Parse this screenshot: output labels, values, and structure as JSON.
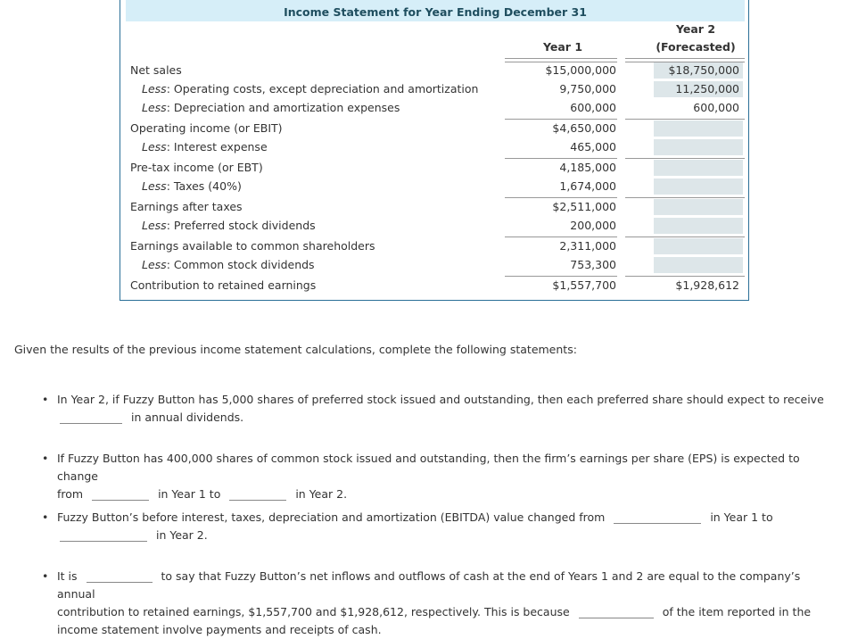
{
  "statement": {
    "title": "Income Statement for Year Ending December 31",
    "col_year1": "Year 1",
    "col_year2_line1": "Year 2",
    "col_year2_line2": "(Forecasted)",
    "rows": [
      {
        "prefix": "",
        "label": "Net sales",
        "year1": "$15,000,000",
        "year2": "$18,750,000",
        "year2_input": true
      },
      {
        "prefix": "Less",
        "label": ": Operating costs, except depreciation and amortization",
        "year1": "9,750,000",
        "year2": "11,250,000",
        "year2_input": true
      },
      {
        "prefix": "Less",
        "label": ": Depreciation and amortization expenses",
        "year1": "600,000",
        "year2": "600,000",
        "year2_input": false
      },
      {
        "prefix": "",
        "label": "Operating income (or EBIT)",
        "year1": "$4,650,000",
        "year2": "",
        "year2_input": true
      },
      {
        "prefix": "Less",
        "label": ": Interest expense",
        "year1": "465,000",
        "year2": "",
        "year2_input": true
      },
      {
        "prefix": "",
        "label": "Pre-tax income (or EBT)",
        "year1": "4,185,000",
        "year2": "",
        "year2_input": true
      },
      {
        "prefix": "Less",
        "label": ": Taxes (40%)",
        "year1": "1,674,000",
        "year2": "",
        "year2_input": true
      },
      {
        "prefix": "",
        "label": "Earnings after taxes",
        "year1": "$2,511,000",
        "year2": "",
        "year2_input": true
      },
      {
        "prefix": "Less",
        "label": ": Preferred stock dividends",
        "year1": "200,000",
        "year2": "",
        "year2_input": true
      },
      {
        "prefix": "",
        "label": "Earnings available to common shareholders",
        "year1": "2,311,000",
        "year2": "",
        "year2_input": true
      },
      {
        "prefix": "Less",
        "label": ": Common stock dividends",
        "year1": "753,300",
        "year2": "",
        "year2_input": true
      },
      {
        "prefix": "",
        "label": "Contribution to retained earnings",
        "year1": "$1,557,700",
        "year2": "$1,928,612",
        "year2_input": false
      }
    ]
  },
  "questions": {
    "intro": "Given the results of the previous income statement calculations, complete the following statements:",
    "q1": {
      "part1": "In Year 2, if Fuzzy Button has 5,000 shares of preferred stock issued and outstanding, then each preferred share should expect to receive",
      "part2": "in annual dividends."
    },
    "q2": {
      "part1": "If Fuzzy Button has 400,000 shares of common stock issued and outstanding, then the firm’s earnings per share (EPS) is expected to change",
      "part2": "from",
      "part3": "in Year 1 to",
      "part4": "in Year 2."
    },
    "q3": {
      "part1": "Fuzzy Button’s before interest, taxes, depreciation and amortization (EBITDA) value changed from",
      "part2": "in Year 1 to",
      "part3": "in Year 2."
    },
    "q4": {
      "part1": "It is",
      "part2": "to say that Fuzzy Button’s net inflows and outflows of cash at the end of Years 1 and 2 are equal to the company’s annual",
      "part3": "contribution to retained earnings, $1,557,700 and $1,928,612, respectively. This is because",
      "part4": "of the item reported in the",
      "part5": "income statement involve payments and receipts of cash."
    }
  }
}
